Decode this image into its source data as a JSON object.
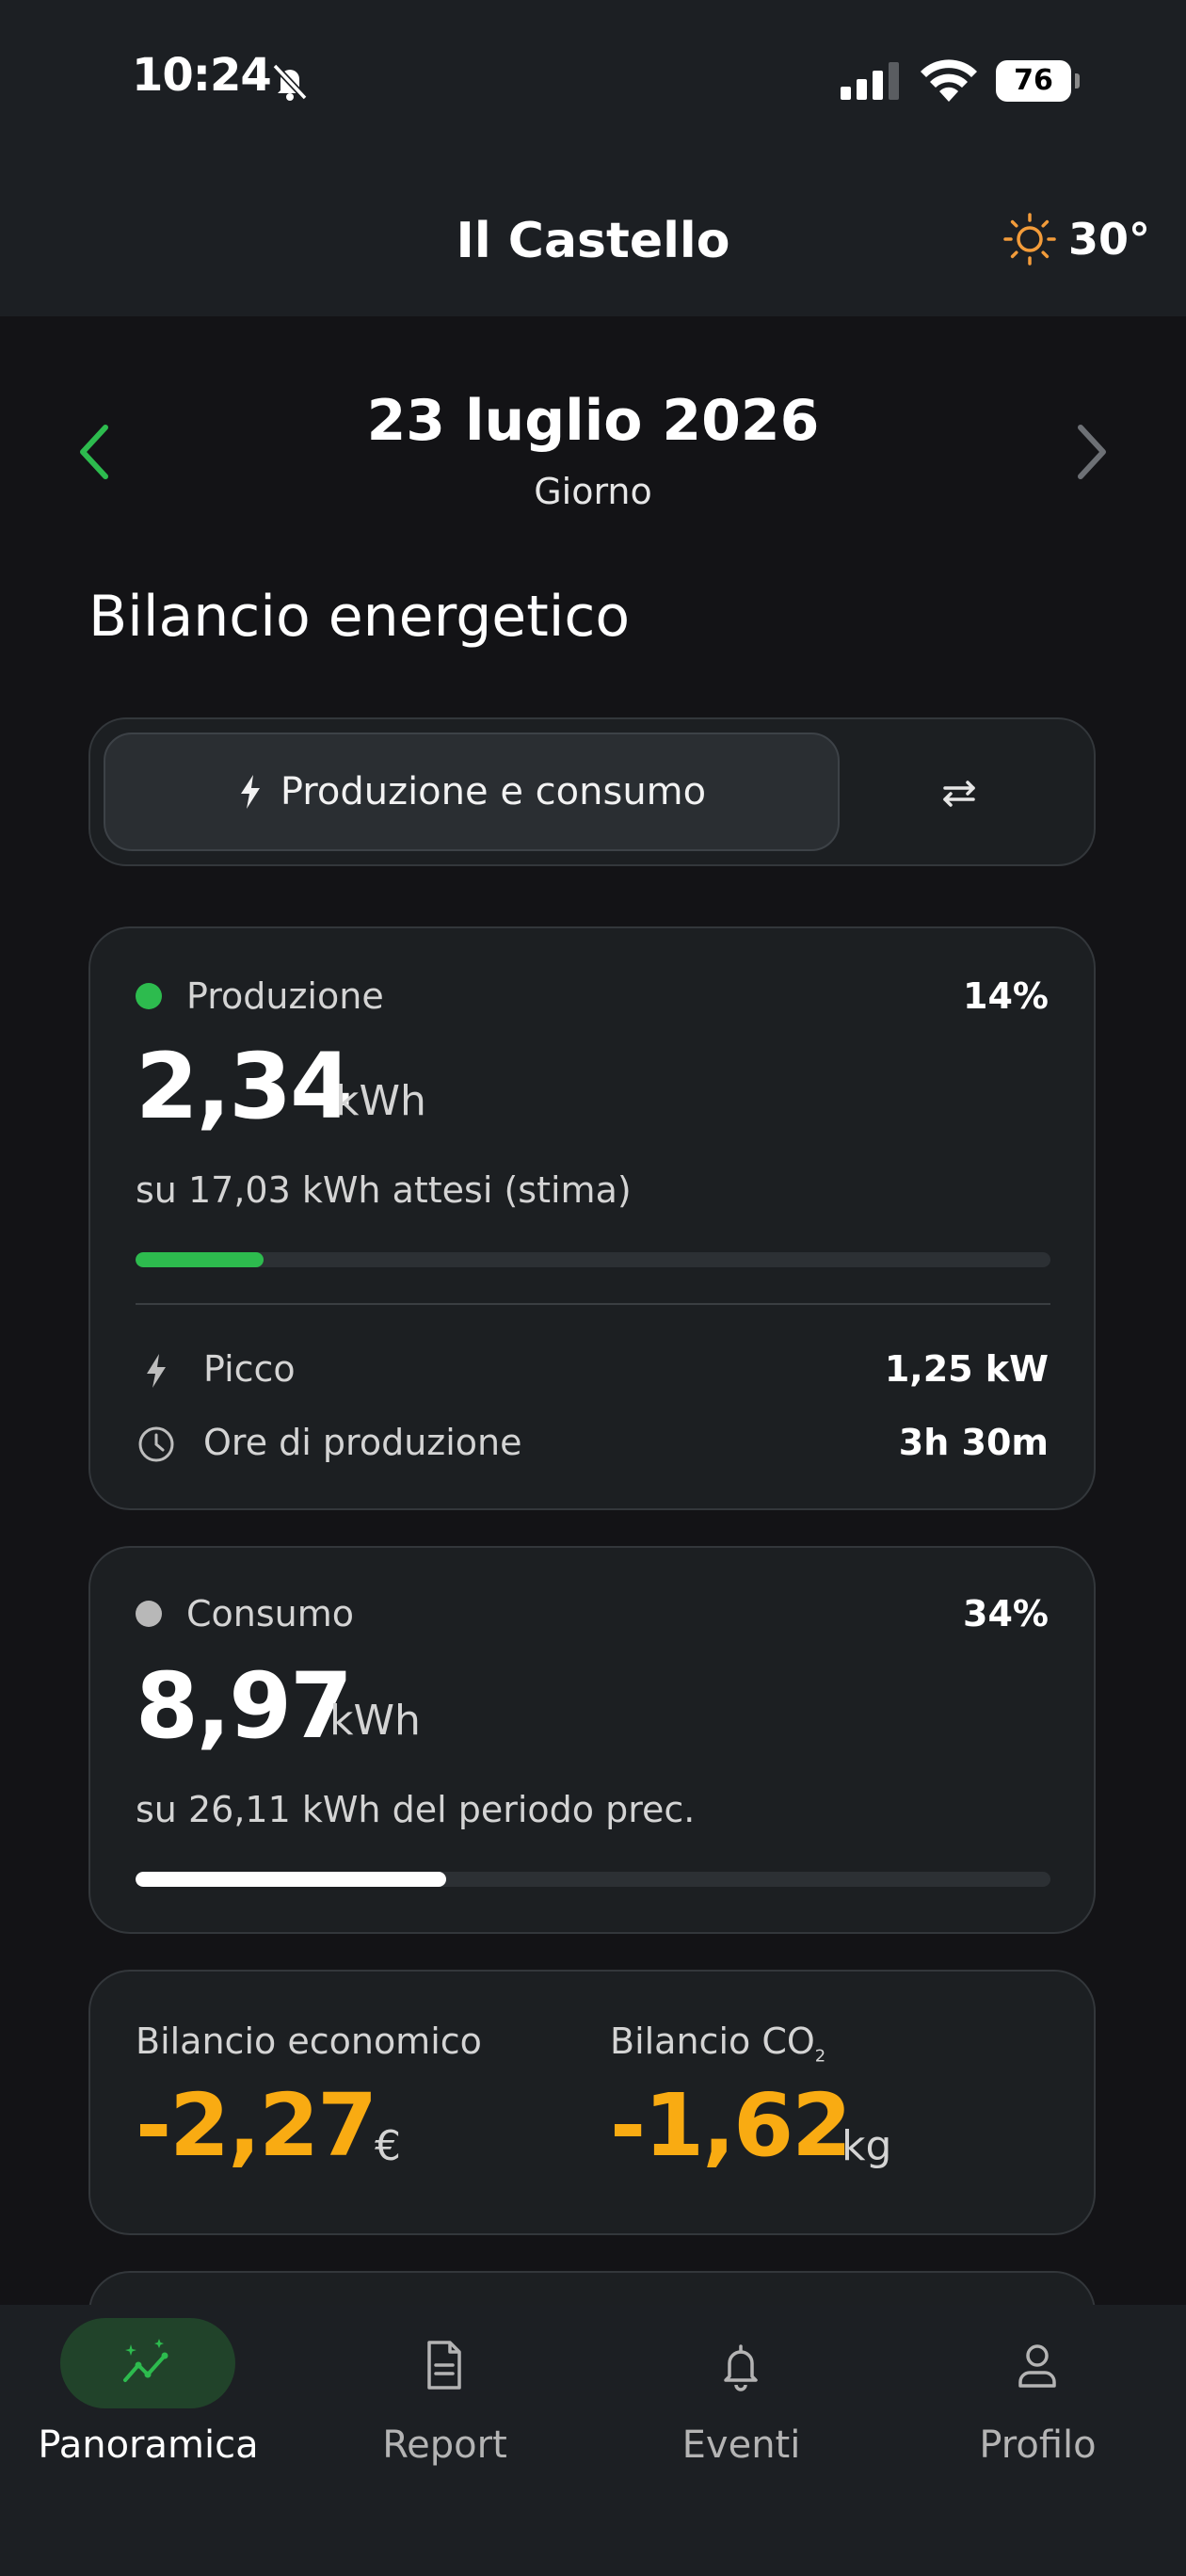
{
  "status_bar": {
    "time": "10:24",
    "battery": "76"
  },
  "header": {
    "title": "Il Castello",
    "temperature": "30°"
  },
  "date_nav": {
    "date": "23 luglio 2026",
    "period": "Giorno"
  },
  "section_title": "Bilancio energetico",
  "segmented": {
    "active_label": "Produzione e consumo"
  },
  "production": {
    "label": "Produzione",
    "percent": "14%",
    "value": "2,34",
    "unit": "kWh",
    "subtitle": "su 17,03 kWh attesi (stima)",
    "progress": 0.14,
    "peak_label": "Picco",
    "peak_value": "1,25 kW",
    "hours_label": "Ore di produzione",
    "hours_value": "3h 30m",
    "color": "#2dbb4e"
  },
  "consumption": {
    "label": "Consumo",
    "percent": "34%",
    "value": "8,97",
    "unit": "kWh",
    "subtitle": "su 26,11 kWh del periodo prec.",
    "progress": 0.34,
    "color": "#ffffff"
  },
  "balance": {
    "economic_label": "Bilancio economico",
    "economic_value": "-2,27",
    "economic_unit": "€",
    "co2_label_prefix": "Bilancio CO",
    "co2_label_sub": "2",
    "co2_value": "-1,62",
    "co2_unit": "kg",
    "accent": "#f9ab12"
  },
  "tabs": [
    {
      "label": "Panoramica",
      "icon": "chart-sparkle-icon",
      "active": true
    },
    {
      "label": "Report",
      "icon": "document-icon",
      "active": false
    },
    {
      "label": "Eventi",
      "icon": "bell-icon",
      "active": false
    },
    {
      "label": "Profilo",
      "icon": "person-icon",
      "active": false
    }
  ]
}
